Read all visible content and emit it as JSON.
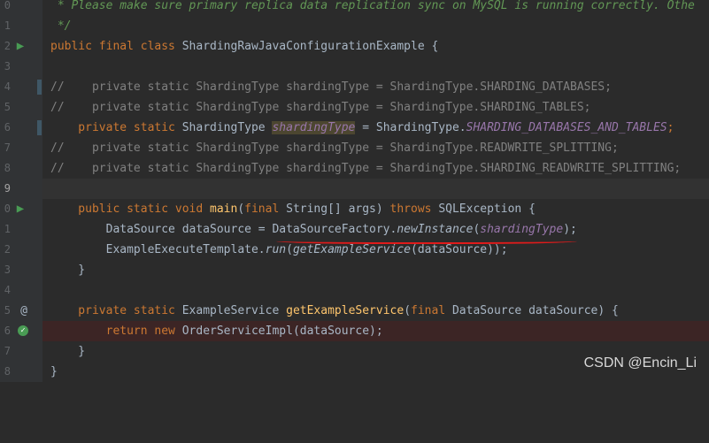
{
  "line_numbers": [
    "0",
    "1",
    "2",
    "3",
    "4",
    "5",
    "6",
    "7",
    "8",
    "9",
    "0",
    "1",
    "2",
    "3",
    "4",
    "5",
    "6",
    "7",
    "8"
  ],
  "lines": {
    "l0": " * Please make sure primary replica data replication sync on MySQL is running correctly. Othe",
    "l1": " */",
    "l2_kw": "public final class ",
    "l2_rest": "ShardingRawJavaConfigurationExample {",
    "l4": "//    private static ShardingType shardingType = ShardingType.SHARDING_DATABASES;",
    "l5": "//    private static ShardingType shardingType = ShardingType.SHARDING_TABLES;",
    "l6_kw": "    private static ",
    "l6_type": "ShardingType ",
    "l6_field": "shardingType",
    "l6_eq": " = ShardingType.",
    "l6_const": "SHARDING_DATABASES_AND_TABLES",
    "l6_end": ";",
    "l7": "//    private static ShardingType shardingType = ShardingType.READWRITE_SPLITTING;",
    "l8": "//    private static ShardingType shardingType = ShardingType.SHARDING_READWRITE_SPLITTING;",
    "l10_kw": "    public static void ",
    "l10_fn": "main",
    "l10_p1": "(",
    "l10_kw2": "final ",
    "l10_p2": "String[] args) ",
    "l10_kw3": "throws ",
    "l10_p3": "SQLException {",
    "l11_a": "        DataSource dataSource = DataSourceFactory.",
    "l11_m": "newInstance",
    "l11_b": "(",
    "l11_arg": "shardingType",
    "l11_c": ");",
    "l12_a": "        ExampleExecuteTemplate.",
    "l12_m": "run",
    "l12_b": "(",
    "l12_m2": "getExampleService",
    "l12_c": "(dataSource));",
    "l13": "    }",
    "l15_kw": "    private static ",
    "l15_a": "ExampleService ",
    "l15_fn": "getExampleService",
    "l15_b": "(",
    "l15_kw2": "final ",
    "l15_c": "DataSource dataSource) {",
    "l16_kw": "        return new ",
    "l16_a": "OrderServiceImpl(dataSource);",
    "l17": "    }",
    "l18": "}"
  },
  "icons": {
    "run": "run-gutter-icon",
    "override": "override-annotation-icon",
    "breakpoint": "breakpoint-check-icon"
  },
  "watermark": "CSDN @Encin_Li",
  "colors": {
    "background": "#2b2b2b",
    "keyword": "#cc7832",
    "comment": "#808080",
    "function": "#ffc66d",
    "static_field": "#9876aa",
    "error_line": "#3c2525",
    "annotation_underline": "#e01b1b"
  }
}
